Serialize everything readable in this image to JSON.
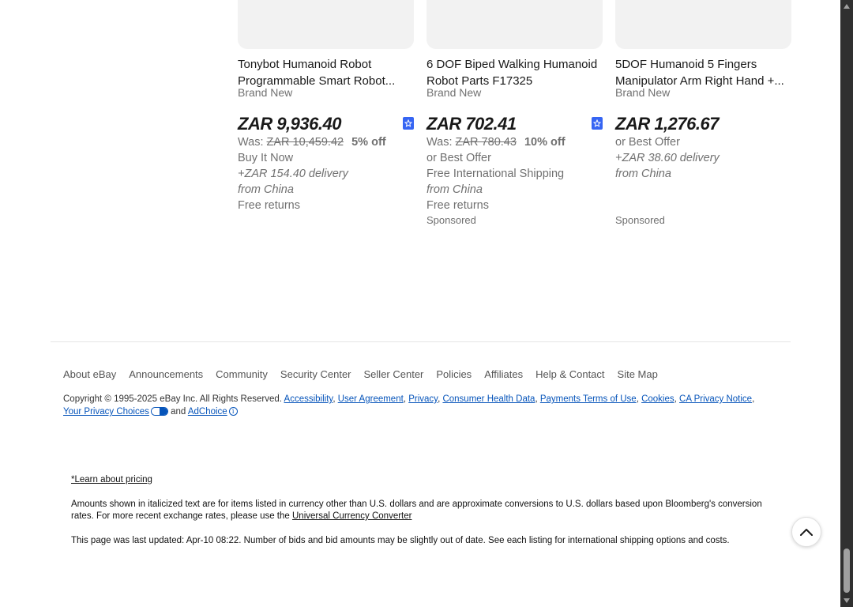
{
  "products": [
    {
      "title_line1": "Tonybot Humanoid Robot",
      "title_line2": "Programmable Smart Robot...",
      "condition": "Brand New",
      "price": "ZAR 9,936.40",
      "was_label": "Was:",
      "was_price": "ZAR 10,459.42",
      "discount": "5% off",
      "buy_format": "Buy It Now",
      "shipping": "+ZAR 154.40 delivery",
      "location": "from China",
      "returns": "Free returns",
      "sponsored": ""
    },
    {
      "title_line1": "6 DOF Biped Walking Humanoid",
      "title_line2": "Robot Parts F17325",
      "condition": "Brand New",
      "price": "ZAR 702.41",
      "was_label": "Was:",
      "was_price": "ZAR 780.43",
      "discount": "10% off",
      "buy_format": "or Best Offer",
      "shipping": "Free International Shipping",
      "location": "from China",
      "returns": "Free returns",
      "sponsored": "Sponsored"
    },
    {
      "title_line1": "5DOF Humanoid 5 Fingers",
      "title_line2": "Manipulator Arm Right Hand +...",
      "condition": "Brand New",
      "price": "ZAR 1,276.67",
      "buy_format": "or Best Offer",
      "shipping": "+ZAR 38.60 delivery",
      "location": "from China",
      "sponsored": "Sponsored"
    }
  ],
  "footer": {
    "links": [
      "About eBay",
      "Announcements",
      "Community",
      "Security Center",
      "Seller Center",
      "Policies",
      "Affiliates",
      "Help & Contact",
      "Site Map"
    ],
    "copyright": "Copyright © 1995-2025 eBay Inc. All Rights Reserved.",
    "legal_links": {
      "accessibility": "Accessibility",
      "user_agreement": "User Agreement",
      "privacy": "Privacy",
      "consumer_health": "Consumer Health Data",
      "payments_terms": "Payments Terms of Use",
      "cookies": "Cookies",
      "ca_privacy": "CA Privacy Notice",
      "privacy_choices": "Your Privacy Choices",
      "and_text": "and",
      "adchoice": "AdChoice"
    }
  },
  "pricing": {
    "learn_link": "*Learn about pricing",
    "amounts_text": "Amounts shown in italicized text are for items listed in currency other than U.S. dollars and are approximate conversions to U.S. dollars based upon Bloomberg's conversion rates. For more recent exchange rates, please use the",
    "converter_link": "Universal Currency Converter",
    "updated_text": "This page was last updated: Apr-10 08:22. Number of bids and bid amounts may be slightly out of date. See each listing for international shipping options and costs."
  },
  "icons": {
    "watch": "watch-star-icon",
    "back_to_top": "chevron-up-icon",
    "privacy_choices": "privacy-toggle-icon",
    "adchoice": "info-icon"
  },
  "colors": {
    "link": "#0654ba",
    "badge": "#3665f3",
    "muted": "#707070"
  }
}
